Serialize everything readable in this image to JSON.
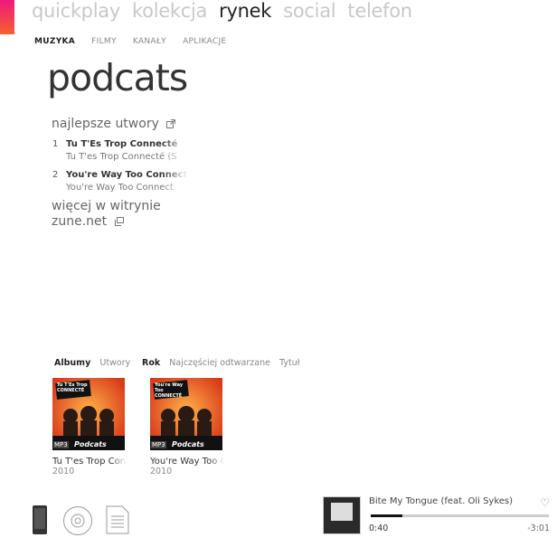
{
  "nav": {
    "pivots": [
      "quickplay",
      "kolekcja",
      "rynek",
      "social",
      "telefon"
    ],
    "active_pivot": "rynek",
    "sub": [
      "MUZYKA",
      "FILMY",
      "KANAŁY",
      "APLIKACJE"
    ],
    "active_sub": "MUZYKA"
  },
  "artist": {
    "name": "podcats",
    "top_tracks_label": "najlepsze utwory",
    "tracks": [
      {
        "num": "1",
        "title": "Tu T'Es Trop Connecté",
        "album": "Tu T'es Trop Connecté (S"
      },
      {
        "num": "2",
        "title": "You're Way Too Connect",
        "album": "You're Way Too Connect"
      }
    ],
    "more_label_line1": "więcej w witrynie",
    "more_label_line2": "zune.net"
  },
  "tabs": {
    "view": [
      "Albumy",
      "Utwory"
    ],
    "sort": [
      "Rok",
      "Najczęściej odtwarzane",
      "Tytuł"
    ]
  },
  "albums": [
    {
      "name": "Tu T'es Trop Connecté",
      "year": "2010",
      "cover_text": "Tu T'Es Trop CONNECTÉ",
      "badge": "MP3",
      "brand": "Podcats"
    },
    {
      "name": "You're Way Too Connected",
      "year": "2010",
      "cover_text": "You're Way Too CONNECTÉ",
      "badge": "MP3",
      "brand": "Podcats"
    }
  ],
  "devices": [
    "phone-icon",
    "disc-icon",
    "document-icon"
  ],
  "now_playing": {
    "title": "Bite My Tongue (feat. Oli Sykes)",
    "elapsed": "0:40",
    "remaining": "-3:01",
    "progress": 0.18
  },
  "colors": {
    "accent_top": "#f0187c",
    "accent_bottom": "#f46030",
    "cover_bg": "#e8542a"
  }
}
